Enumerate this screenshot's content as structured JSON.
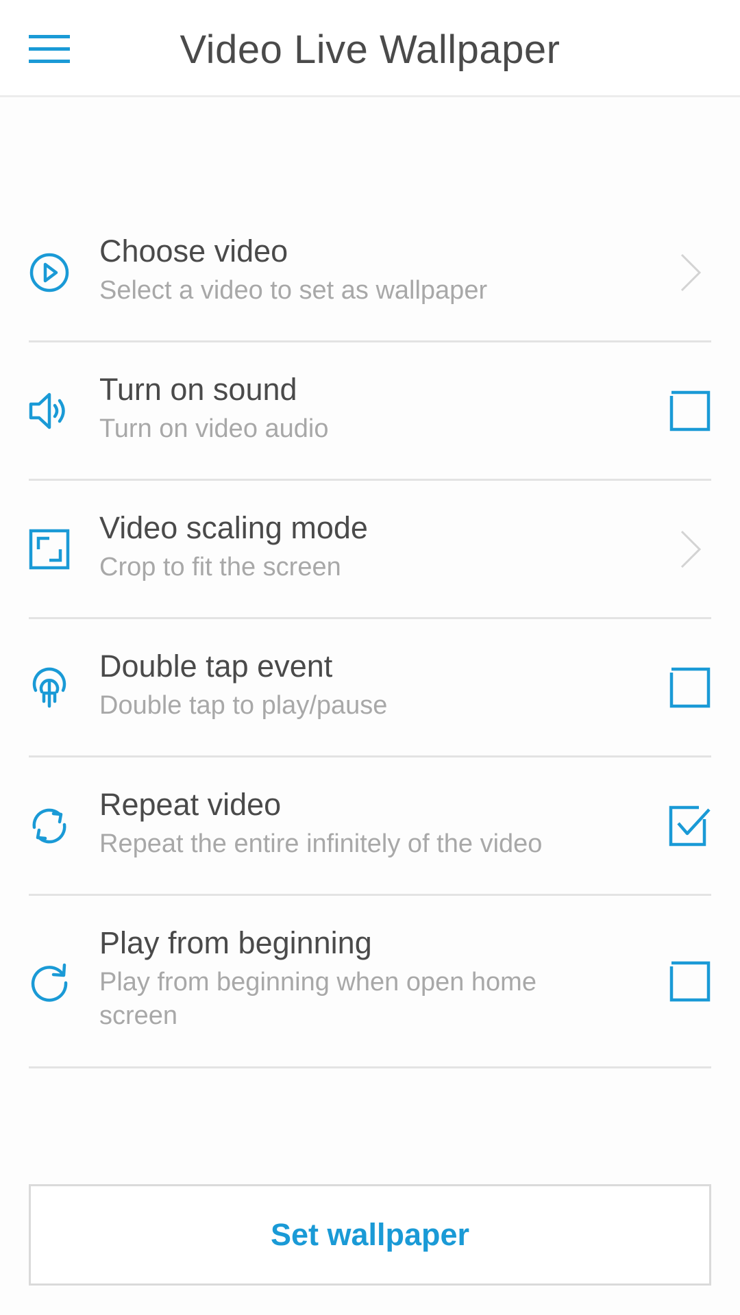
{
  "app": {
    "title": "Video Live Wallpaper",
    "accent_color": "#1a9ad6"
  },
  "header": {
    "menu_icon": "hamburger-menu-icon"
  },
  "settings": [
    {
      "id": "choose-video",
      "title": "Choose video",
      "subtitle": "Select a video to set as wallpaper",
      "icon": "play-circle-icon",
      "control": "chevron"
    },
    {
      "id": "turn-on-sound",
      "title": "Turn on sound",
      "subtitle": "Turn on video audio",
      "icon": "speaker-icon",
      "control": "checkbox",
      "checked": false
    },
    {
      "id": "video-scaling-mode",
      "title": "Video scaling mode",
      "subtitle": "Crop to fit the screen",
      "icon": "crop-frame-icon",
      "control": "chevron"
    },
    {
      "id": "double-tap-event",
      "title": "Double tap event",
      "subtitle": "Double tap to play/pause",
      "icon": "tap-gesture-icon",
      "control": "checkbox",
      "checked": false
    },
    {
      "id": "repeat-video",
      "title": "Repeat video",
      "subtitle": "Repeat the entire infinitely of the video",
      "icon": "repeat-icon",
      "control": "checkbox",
      "checked": true
    },
    {
      "id": "play-from-beginning",
      "title": "Play from beginning",
      "subtitle": "Play from beginning when open home screen",
      "icon": "restart-icon",
      "control": "checkbox",
      "checked": false
    }
  ],
  "actions": {
    "set_wallpaper_label": "Set wallpaper"
  }
}
